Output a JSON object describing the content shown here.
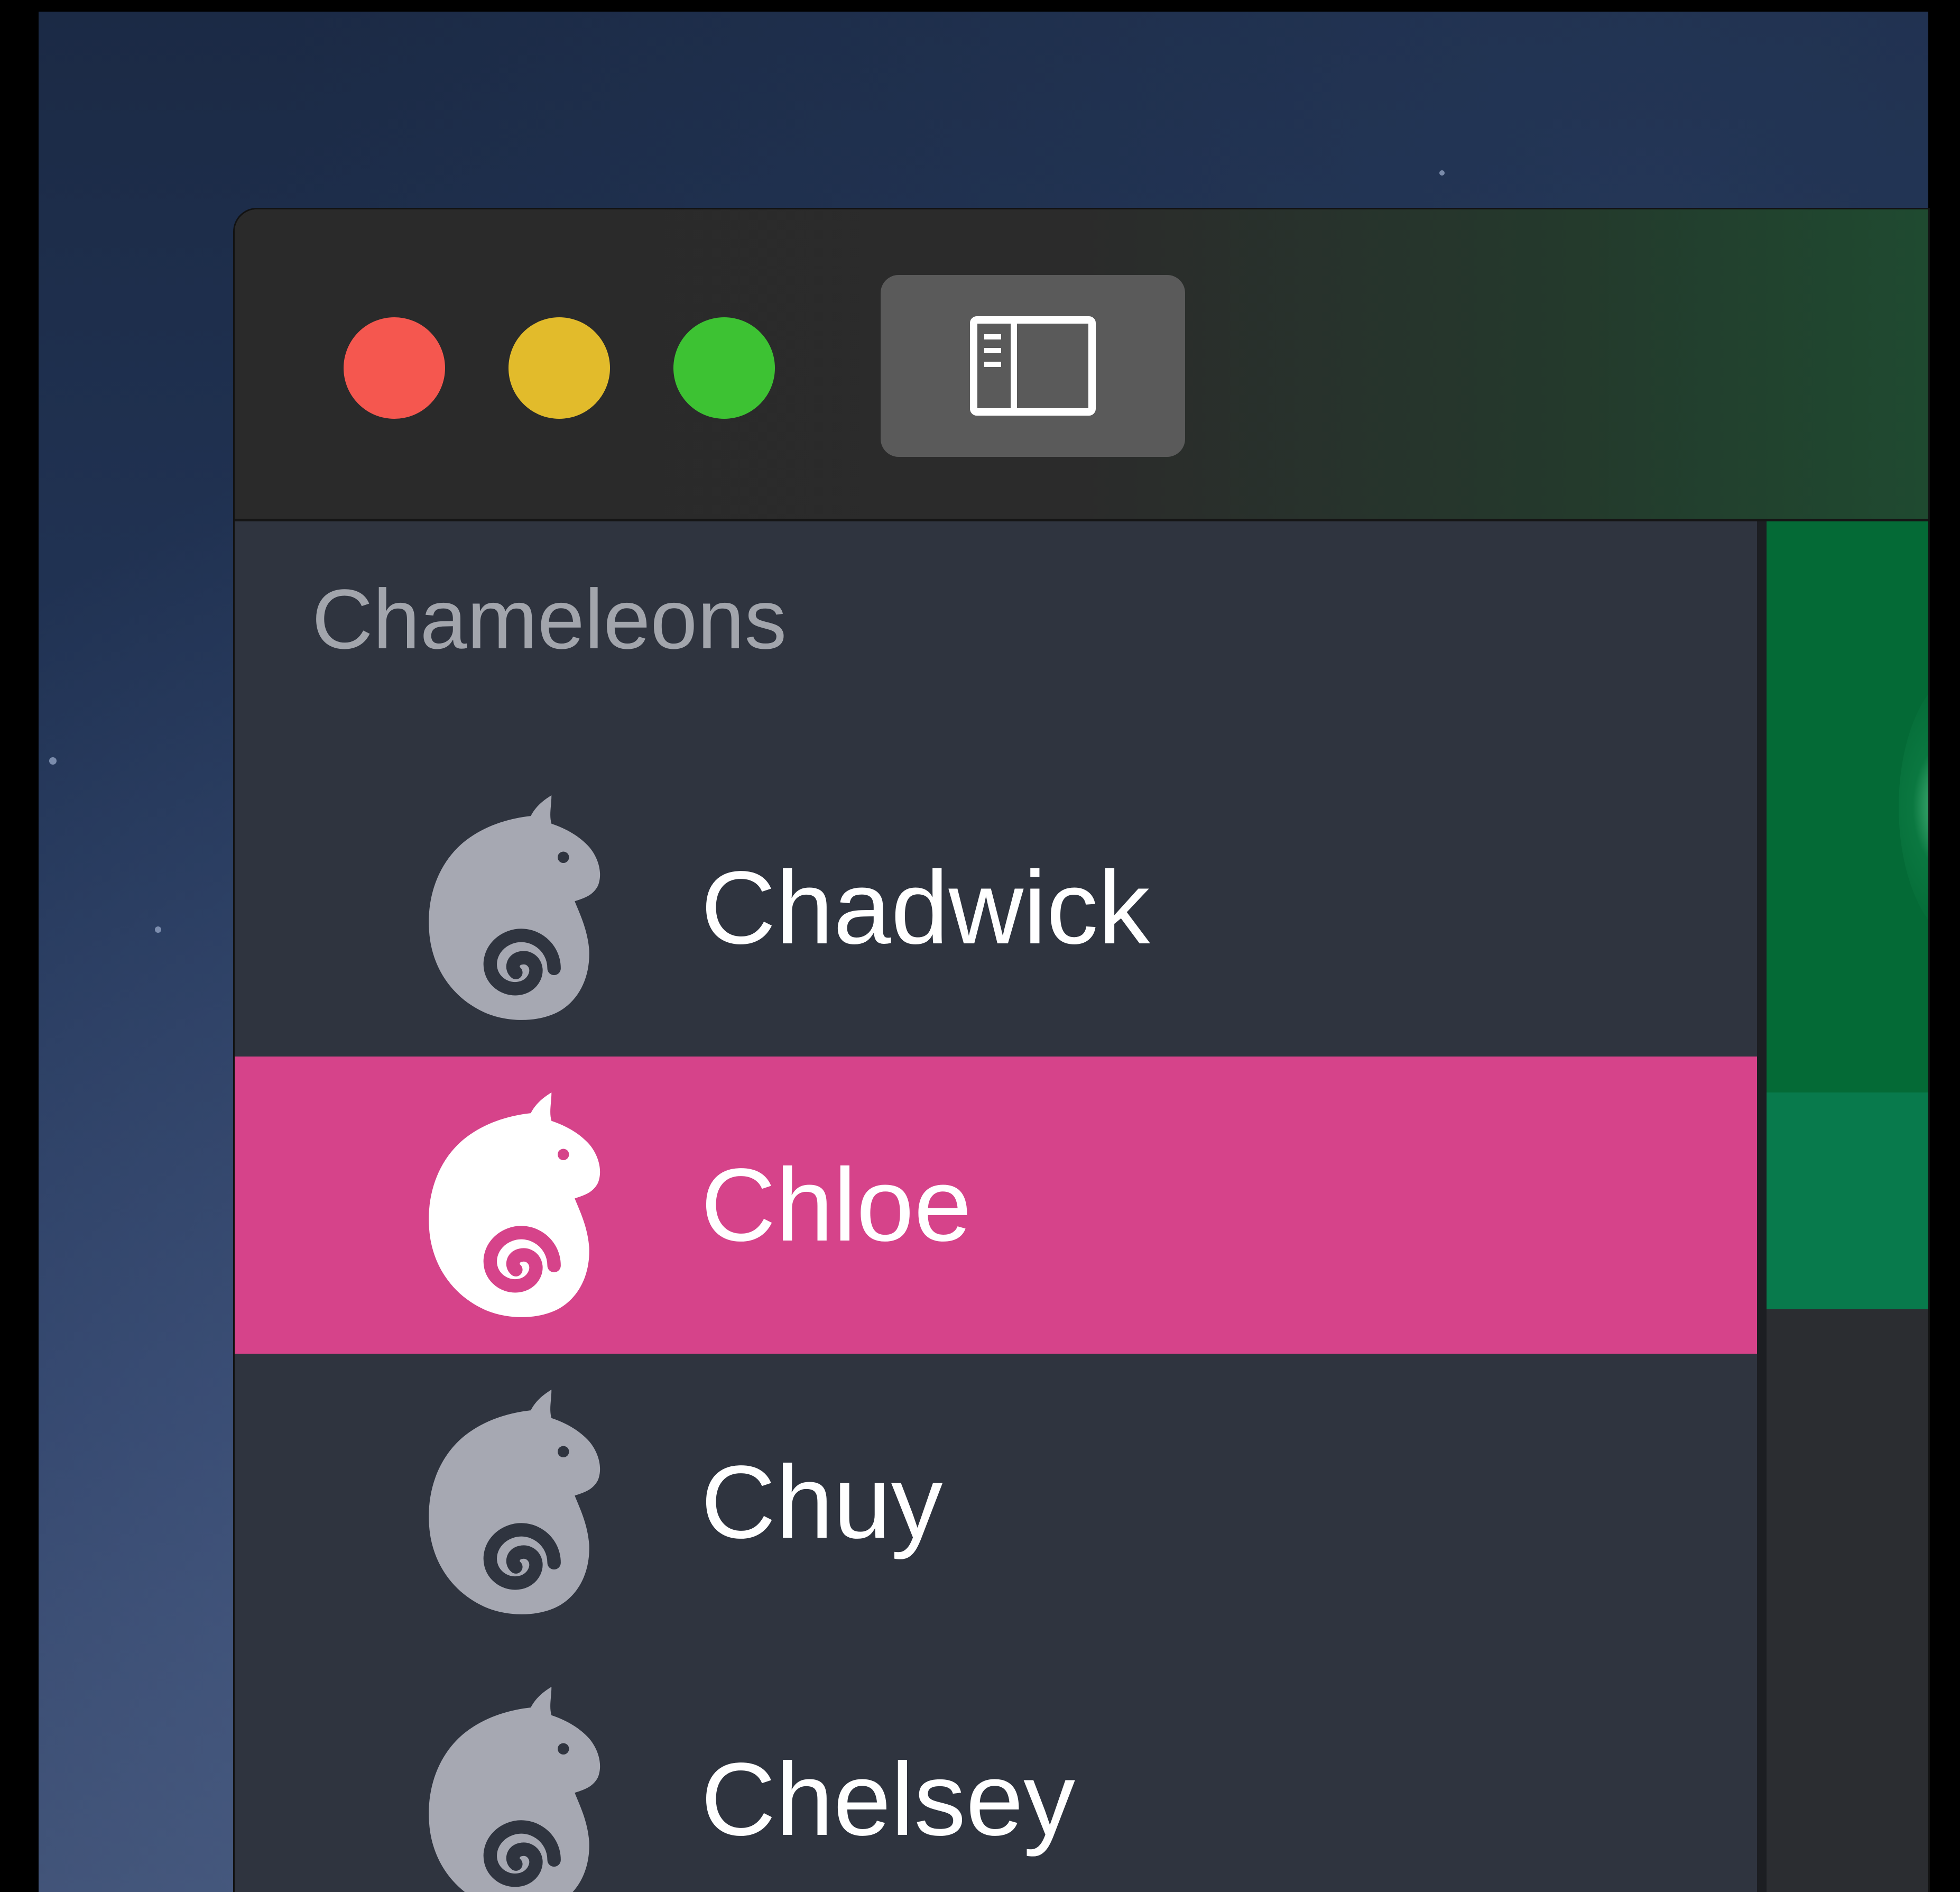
{
  "window": {
    "controls": {
      "close": "close",
      "minimize": "minimize",
      "maximize": "zoom"
    },
    "toolbar": {
      "sidebar_toggle_icon": "sidebar-toggle-icon"
    }
  },
  "sidebar": {
    "section_title": "Chameleons",
    "items": [
      {
        "label": "Chadwick",
        "icon": "chameleon-icon",
        "selected": false
      },
      {
        "label": "Chloe",
        "icon": "chameleon-icon",
        "selected": true
      },
      {
        "label": "Chuy",
        "icon": "chameleon-icon",
        "selected": false
      },
      {
        "label": "Chelsey",
        "icon": "chameleon-icon",
        "selected": false
      }
    ]
  },
  "colors": {
    "selection": "#d6438a",
    "sidebar_background": "#2f343f",
    "icon_default": "#a6a8b2",
    "icon_selected": "#ffffff",
    "detail_green": "#046a36"
  }
}
